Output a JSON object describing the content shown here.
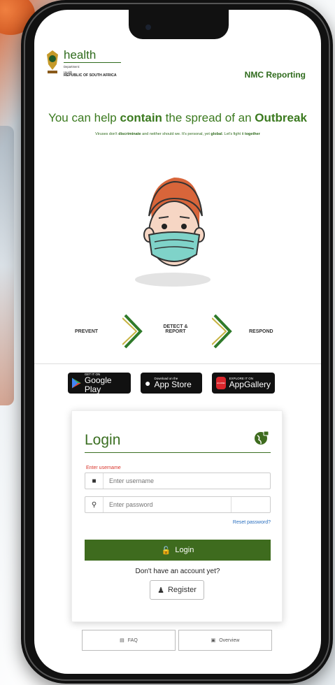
{
  "header": {
    "brand_name": "health",
    "dept_line1": "Department:",
    "dept_line2": "Health",
    "dept_line3": "REPUBLIC OF SOUTH AFRICA",
    "app_title": "NMC Reporting"
  },
  "hero": {
    "headline_pre": "You can help ",
    "headline_bold1": "contain",
    "headline_mid": " the spread of an ",
    "headline_bold2": "Outbreak",
    "sub_pre": "Viruses don't ",
    "sub_bold1": "discriminate",
    "sub_mid": " and neither should we. It's personal, yet ",
    "sub_bold2": "global",
    "sub_post": ". Let's fight it ",
    "sub_bold3": "together"
  },
  "steps": {
    "prevent": "PREVENT",
    "detect_line1": "DETECT &",
    "detect_line2": "REPORT",
    "respond": "RESPOND"
  },
  "stores": {
    "google_small": "GET IT ON",
    "google_big": "Google Play",
    "apple_small": "Download on the",
    "apple_big": "App Store",
    "huawei_small": "EXPLORE IT ON",
    "huawei_big": "AppGallery",
    "huawei_logo": "HUAWEI"
  },
  "login": {
    "title": "Login",
    "error_text": "Enter username",
    "username_placeholder": "Enter username",
    "password_placeholder": "Enter password",
    "reset_link": "Reset password?",
    "login_button": "Login",
    "no_account": "Don't have an account yet?",
    "register_button": "Register"
  },
  "footer": {
    "faq": "FAQ",
    "overview": "Overview"
  },
  "colors": {
    "primary_green": "#3e6b1e",
    "brand_green": "#2f6b1d",
    "error_red": "#d9342b",
    "link_blue": "#2a6fbf"
  },
  "icons": [
    "user-icon",
    "key-icon",
    "lock-icon",
    "register-icon",
    "faq-icon",
    "monitor-icon",
    "globe-lock-icon",
    "chevron-right-icon",
    "google-play-icon",
    "apple-icon",
    "huawei-icon"
  ]
}
